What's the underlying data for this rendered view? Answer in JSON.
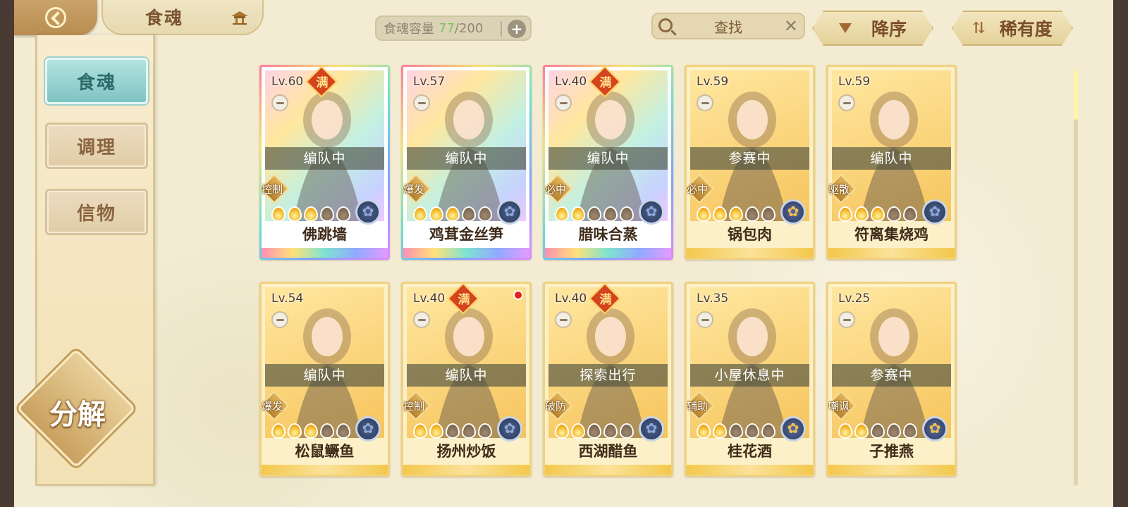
{
  "header": {
    "title": "食魂",
    "capacity_label": "食魂容量",
    "capacity_current": "77",
    "capacity_total": "/200",
    "search_label": "查找",
    "sort_order_label": "降序",
    "sort_field_label": "稀有度"
  },
  "sidebar": {
    "tabs": [
      {
        "label": "食魂"
      },
      {
        "label": "调理"
      },
      {
        "label": "信物"
      }
    ],
    "decompose_label": "分解"
  },
  "colors": {
    "background": "#f3ecd3",
    "accent_teal": "#7fc4c2",
    "gold_border": "#f1d17e",
    "status_overlay": "#464a3c"
  },
  "cards": [
    {
      "level": "Lv.60",
      "full_badge": "满",
      "status": "编队中",
      "role": "控制",
      "stars": 3,
      "name": "佛跳墙",
      "rarity_style": "special",
      "element": "blue-flower-icon"
    },
    {
      "level": "Lv.57",
      "full_badge": "",
      "status": "编队中",
      "role": "爆发",
      "stars": 3,
      "name": "鸡茸金丝笋",
      "rarity_style": "special",
      "element": "blue-flower-icon"
    },
    {
      "level": "Lv.40",
      "full_badge": "满",
      "status": "编队中",
      "role": "必中",
      "stars": 2,
      "name": "腊味合蒸",
      "rarity_style": "special",
      "element": "blue-flower-icon"
    },
    {
      "level": "Lv.59",
      "full_badge": "",
      "status": "参赛中",
      "role": "必中",
      "stars": 3,
      "name": "锅包肉",
      "rarity_style": "gold",
      "element": "gold-flower-icon"
    },
    {
      "level": "Lv.59",
      "full_badge": "",
      "status": "编队中",
      "role": "驱散",
      "stars": 3,
      "name": "符离集烧鸡",
      "rarity_style": "gold",
      "element": "blue-flower-icon"
    },
    {
      "level": "Lv.54",
      "full_badge": "",
      "status": "编队中",
      "role": "爆发",
      "stars": 3,
      "name": "松鼠鳜鱼",
      "rarity_style": "gold",
      "element": "blue-flower-icon"
    },
    {
      "level": "Lv.40",
      "full_badge": "满",
      "status": "编队中",
      "role": "控制",
      "stars": 2,
      "name": "扬州炒饭",
      "rarity_style": "gold",
      "element": "blue-flower-icon",
      "notification": true
    },
    {
      "level": "Lv.40",
      "full_badge": "满",
      "status": "探索出行",
      "role": "破防",
      "stars": 2,
      "name": "西湖醋鱼",
      "rarity_style": "gold",
      "element": "blue-flower-icon"
    },
    {
      "level": "Lv.35",
      "full_badge": "",
      "status": "小屋休息中",
      "role": "辅助",
      "stars": 2,
      "name": "桂花酒",
      "rarity_style": "gold",
      "element": "gold-flower-icon"
    },
    {
      "level": "Lv.25",
      "full_badge": "",
      "status": "参赛中",
      "role": "嘲讽",
      "stars": 2,
      "name": "子推燕",
      "rarity_style": "gold",
      "element": "gold-flower-icon"
    }
  ]
}
